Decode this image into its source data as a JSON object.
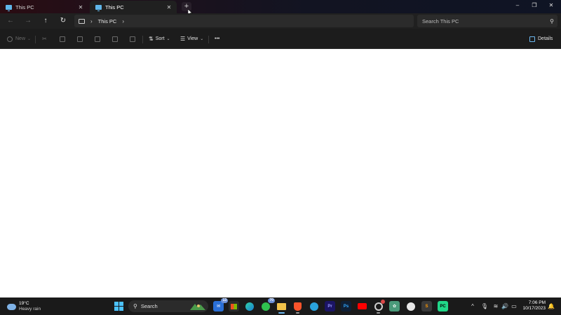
{
  "window": {
    "tabs": [
      {
        "label": "This PC",
        "active": false
      },
      {
        "label": "This PC",
        "active": true
      }
    ],
    "new_tab_symbol": "+",
    "controls": {
      "minimize": "–",
      "maximize": "❐",
      "close": "✕"
    }
  },
  "nav": {
    "back": "←",
    "forward": "→",
    "up": "↑",
    "refresh": "↻",
    "breadcrumb": [
      "This PC"
    ],
    "search_placeholder": "Search This PC"
  },
  "commandbar": {
    "new_label": "New",
    "sort_label": "Sort",
    "view_label": "View",
    "more_label": "•••",
    "details_label": "Details"
  },
  "taskbar": {
    "weather": {
      "temp": "19°C",
      "condition": "Heavy rain"
    },
    "search_label": "Search",
    "mail_badge": "13",
    "whatsapp_badge": "70",
    "apps": [
      {
        "name": "Premiere Pro",
        "abbr": "Pr",
        "color": "#1b1464"
      },
      {
        "name": "Photoshop",
        "abbr": "Ps",
        "color": "#0f1f35"
      }
    ],
    "clock": {
      "time": "7:06 PM",
      "date": "10/17/2023"
    }
  },
  "colors": {
    "accent": "#5fb6ea",
    "titlebar_left": "#2a0c12",
    "content_bg": "#ffffff",
    "taskbar_bg": "#1a1a1a"
  }
}
